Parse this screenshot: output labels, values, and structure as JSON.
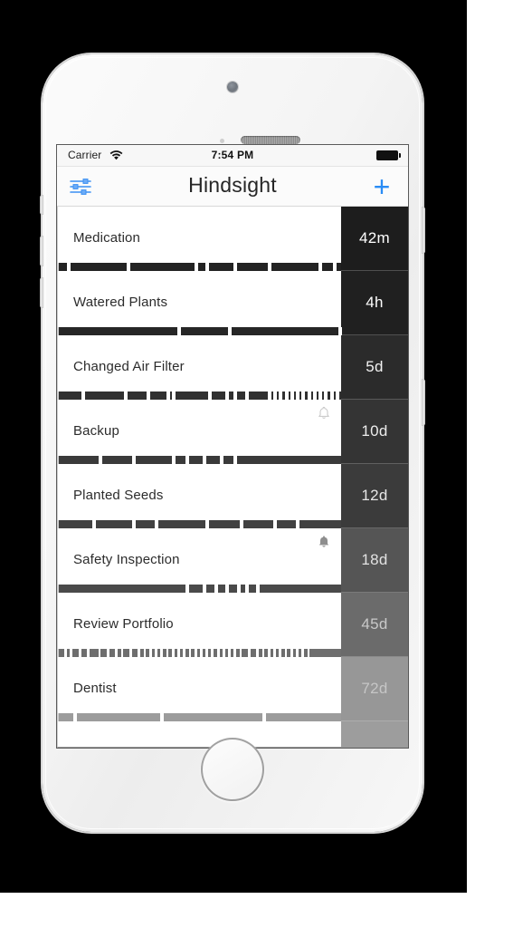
{
  "device": {
    "name": "iphone-white",
    "backdrop_color": "#000000",
    "body_color": "#f4f4f4"
  },
  "status_bar": {
    "carrier": "Carrier",
    "wifi_icon": "wifi-icon",
    "time": "7:54 PM",
    "battery_icon": "battery-full-icon"
  },
  "nav_bar": {
    "left_icon": "sliders-icon",
    "title": "Hindsight",
    "right_label": "+",
    "accent_color": "#2a8cf5"
  },
  "list": {
    "rows": [
      {
        "label": "Medication",
        "elapsed": "42m",
        "badge_bg": "#1d1d1d",
        "badge_fg": "#ffffff",
        "tick_color": "#232323",
        "bell": "none",
        "ticks": [
          3,
          24,
          48,
          52,
          62,
          74,
          92,
          97
        ]
      },
      {
        "label": "Watered Plants",
        "elapsed": "4h",
        "badge_bg": "#202020",
        "badge_fg": "#fdfdfd",
        "tick_color": "#262626",
        "bell": "none",
        "ticks": [
          42,
          60,
          99
        ]
      },
      {
        "label": "Changed Air Filter",
        "elapsed": "5d",
        "badge_bg": "#2b2b2b",
        "badge_fg": "#f2f2f2",
        "tick_color": "#303030",
        "bell": "none",
        "ticks": [
          8,
          23,
          31,
          38,
          40,
          53,
          59,
          62,
          66,
          74,
          76,
          78,
          80,
          82,
          84,
          86,
          88,
          90,
          92,
          94,
          96,
          98
        ]
      },
      {
        "label": "Backup",
        "elapsed": "10d",
        "badge_bg": "#343434",
        "badge_fg": "#ededed",
        "tick_color": "#3a3a3a",
        "bell": "outline",
        "ticks": [
          14,
          26,
          40,
          45,
          51,
          57,
          62
        ]
      },
      {
        "label": "Planted Seeds",
        "elapsed": "12d",
        "badge_bg": "#3b3b3b",
        "badge_fg": "#e6e6e6",
        "tick_color": "#414141",
        "bell": "none",
        "ticks": [
          12,
          26,
          34,
          52,
          64,
          76,
          84
        ]
      },
      {
        "label": "Safety Inspection",
        "elapsed": "18d",
        "badge_bg": "#555555",
        "badge_fg": "#e2e2e2",
        "tick_color": "#4a4a4a",
        "bell": "filled",
        "ticks": [
          45,
          51,
          55,
          59,
          63,
          66,
          70
        ]
      },
      {
        "label": "Review Portfolio",
        "elapsed": "45d",
        "badge_bg": "#6b6b6b",
        "badge_fg": "#c9c9c9",
        "tick_color": "#6e6e6e",
        "bell": "none",
        "ticks": [
          2,
          4,
          7,
          10,
          14,
          17,
          20,
          22,
          25,
          28,
          30,
          32,
          34,
          36,
          38,
          40,
          42,
          44,
          46,
          48,
          50,
          52,
          54,
          56,
          58,
          60,
          62,
          64,
          67,
          70,
          72,
          74,
          76,
          78,
          80,
          82,
          84,
          86,
          88
        ],
        "dense": true
      },
      {
        "label": "Dentist",
        "elapsed": "72d",
        "badge_bg": "#979797",
        "badge_fg": "#c6c6c6",
        "tick_color": "#9c9c9c",
        "bell": "none",
        "ticks": [
          5,
          36,
          72
        ]
      }
    ],
    "partial_row": {
      "badge_bg": "#9d9d9d"
    }
  }
}
